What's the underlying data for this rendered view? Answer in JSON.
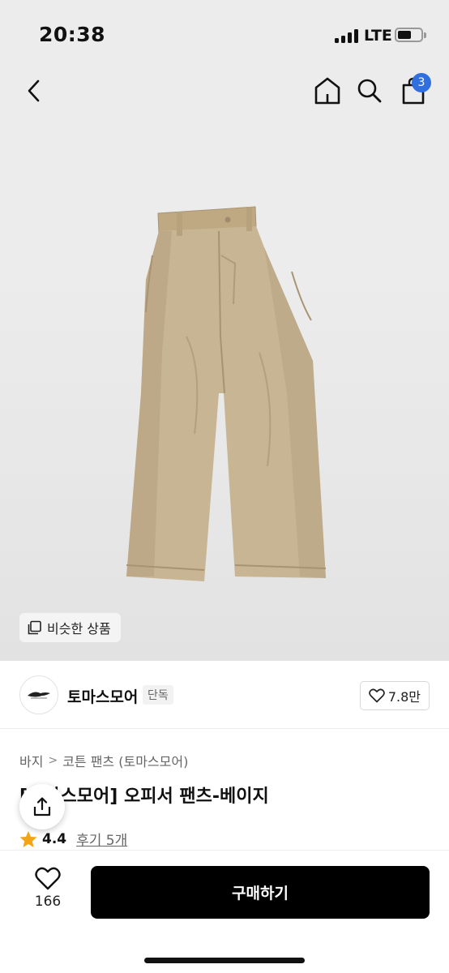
{
  "status_bar": {
    "time": "20:38",
    "network": "LTE"
  },
  "header": {
    "cart_count": "3"
  },
  "gallery": {
    "similar_label": "비슷한 상품",
    "image_colors": {
      "fabric": "#c8b593",
      "shadow": "#ab9877"
    }
  },
  "brand": {
    "name": "토마스모어",
    "badge": "단독",
    "likes": "7.8만"
  },
  "breadcrumb": {
    "category": "바지",
    "separator": ">",
    "subcategory": "코튼 팬츠 (토마스모어)"
  },
  "product": {
    "title": "[토마스모어] 오피서 팬츠-베이지",
    "rating": "4.4",
    "reviews": "후기 5개"
  },
  "bottom": {
    "wish_count": "166",
    "buy_label": "구매하기"
  },
  "colors": {
    "accent_blue": "#2f6fe0",
    "buy_button": "#000000",
    "star": "#f2a516"
  }
}
